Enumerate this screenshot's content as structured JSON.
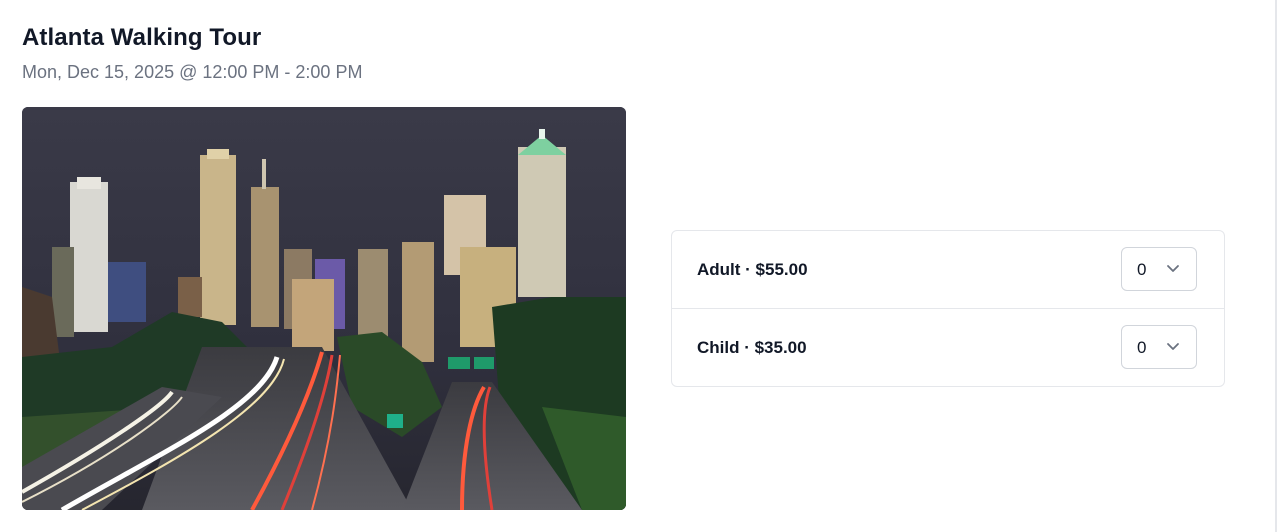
{
  "event": {
    "title": "Atlanta Walking Tour",
    "datetime": "Mon, Dec 15, 2025 @ 12:00 PM - 2:00 PM"
  },
  "tickets": [
    {
      "label": "Adult · $55.00",
      "quantity": "0"
    },
    {
      "label": "Child · $35.00",
      "quantity": "0"
    }
  ],
  "icons": {
    "select_arrow": "chevron-down-icon"
  },
  "colors": {
    "text_primary": "#111827",
    "text_secondary": "#6b7280",
    "border": "#e5e7eb"
  }
}
